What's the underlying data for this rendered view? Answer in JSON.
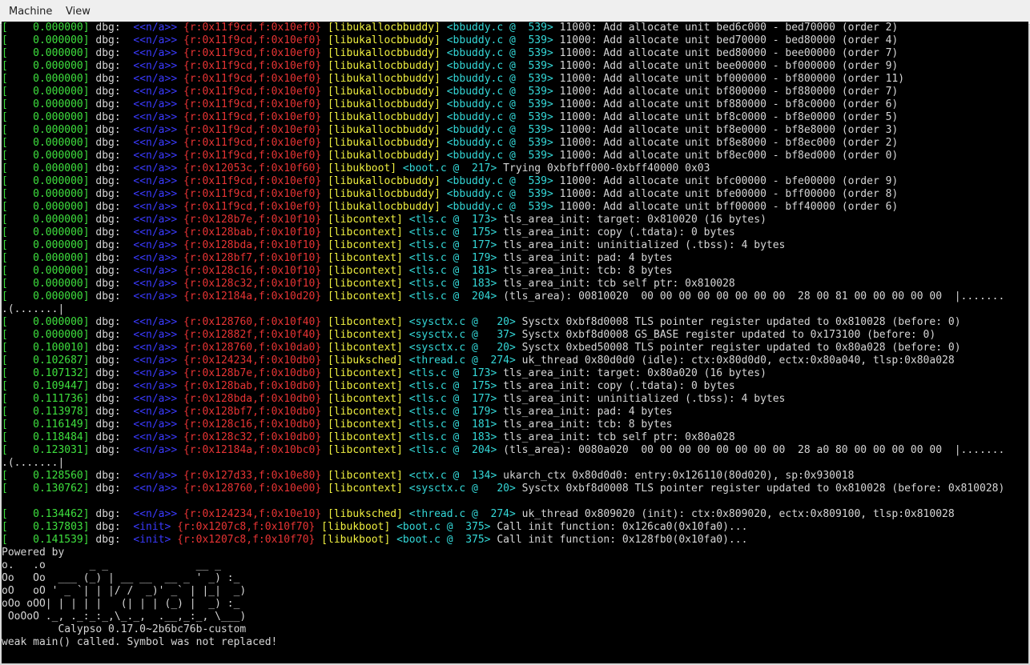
{
  "menu": {
    "machine": "Machine",
    "view": "View"
  },
  "log": [
    {
      "ts": "[    0.000000]",
      "lvl": " dbg: ",
      "ctx": " <<n/a>>",
      "frame": " {r:0x11f9cd,f:0x10ef0}",
      "lib": " [libukallocbbuddy]",
      "src": " <bbuddy.c @  539>",
      "msg": " 11000: Add allocate unit bed6c000 - bed70000 (order 2)"
    },
    {
      "ts": "[    0.000000]",
      "lvl": " dbg: ",
      "ctx": " <<n/a>>",
      "frame": " {r:0x11f9cd,f:0x10ef0}",
      "lib": " [libukallocbbuddy]",
      "src": " <bbuddy.c @  539>",
      "msg": " 11000: Add allocate unit bed70000 - bed80000 (order 4)"
    },
    {
      "ts": "[    0.000000]",
      "lvl": " dbg: ",
      "ctx": " <<n/a>>",
      "frame": " {r:0x11f9cd,f:0x10ef0}",
      "lib": " [libukallocbbuddy]",
      "src": " <bbuddy.c @  539>",
      "msg": " 11000: Add allocate unit bed80000 - bee00000 (order 7)"
    },
    {
      "ts": "[    0.000000]",
      "lvl": " dbg: ",
      "ctx": " <<n/a>>",
      "frame": " {r:0x11f9cd,f:0x10ef0}",
      "lib": " [libukallocbbuddy]",
      "src": " <bbuddy.c @  539>",
      "msg": " 11000: Add allocate unit bee00000 - bf000000 (order 9)"
    },
    {
      "ts": "[    0.000000]",
      "lvl": " dbg: ",
      "ctx": " <<n/a>>",
      "frame": " {r:0x11f9cd,f:0x10ef0}",
      "lib": " [libukallocbbuddy]",
      "src": " <bbuddy.c @  539>",
      "msg": " 11000: Add allocate unit bf000000 - bf800000 (order 11)"
    },
    {
      "ts": "[    0.000000]",
      "lvl": " dbg: ",
      "ctx": " <<n/a>>",
      "frame": " {r:0x11f9cd,f:0x10ef0}",
      "lib": " [libukallocbbuddy]",
      "src": " <bbuddy.c @  539>",
      "msg": " 11000: Add allocate unit bf800000 - bf880000 (order 7)"
    },
    {
      "ts": "[    0.000000]",
      "lvl": " dbg: ",
      "ctx": " <<n/a>>",
      "frame": " {r:0x11f9cd,f:0x10ef0}",
      "lib": " [libukallocbbuddy]",
      "src": " <bbuddy.c @  539>",
      "msg": " 11000: Add allocate unit bf880000 - bf8c0000 (order 6)"
    },
    {
      "ts": "[    0.000000]",
      "lvl": " dbg: ",
      "ctx": " <<n/a>>",
      "frame": " {r:0x11f9cd,f:0x10ef0}",
      "lib": " [libukallocbbuddy]",
      "src": " <bbuddy.c @  539>",
      "msg": " 11000: Add allocate unit bf8c0000 - bf8e0000 (order 5)"
    },
    {
      "ts": "[    0.000000]",
      "lvl": " dbg: ",
      "ctx": " <<n/a>>",
      "frame": " {r:0x11f9cd,f:0x10ef0}",
      "lib": " [libukallocbbuddy]",
      "src": " <bbuddy.c @  539>",
      "msg": " 11000: Add allocate unit bf8e0000 - bf8e8000 (order 3)"
    },
    {
      "ts": "[    0.000000]",
      "lvl": " dbg: ",
      "ctx": " <<n/a>>",
      "frame": " {r:0x11f9cd,f:0x10ef0}",
      "lib": " [libukallocbbuddy]",
      "src": " <bbuddy.c @  539>",
      "msg": " 11000: Add allocate unit bf8e8000 - bf8ec000 (order 2)"
    },
    {
      "ts": "[    0.000000]",
      "lvl": " dbg: ",
      "ctx": " <<n/a>>",
      "frame": " {r:0x11f9cd,f:0x10ef0}",
      "lib": " [libukallocbbuddy]",
      "src": " <bbuddy.c @  539>",
      "msg": " 11000: Add allocate unit bf8ec000 - bf8ed000 (order 0)"
    },
    {
      "ts": "[    0.000000]",
      "lvl": " dbg: ",
      "ctx": " <<n/a>>",
      "frame": " {r:0x12053c,f:0x10f60}",
      "lib": " [libukboot]",
      "src": " <boot.c @  217>",
      "msg": " Trying 0xbfbff000-0xbff40000 0x03"
    },
    {
      "ts": "[    0.000000]",
      "lvl": " dbg: ",
      "ctx": " <<n/a>>",
      "frame": " {r:0x11f9cd,f:0x10ef0}",
      "lib": " [libukallocbbuddy]",
      "src": " <bbuddy.c @  539>",
      "msg": " 11000: Add allocate unit bfc00000 - bfe00000 (order 9)"
    },
    {
      "ts": "[    0.000000]",
      "lvl": " dbg: ",
      "ctx": " <<n/a>>",
      "frame": " {r:0x11f9cd,f:0x10ef0}",
      "lib": " [libukallocbbuddy]",
      "src": " <bbuddy.c @  539>",
      "msg": " 11000: Add allocate unit bfe00000 - bff00000 (order 8)"
    },
    {
      "ts": "[    0.000000]",
      "lvl": " dbg: ",
      "ctx": " <<n/a>>",
      "frame": " {r:0x11f9cd,f:0x10ef0}",
      "lib": " [libukallocbbuddy]",
      "src": " <bbuddy.c @  539>",
      "msg": " 11000: Add allocate unit bff00000 - bff40000 (order 6)"
    },
    {
      "ts": "[    0.000000]",
      "lvl": " dbg: ",
      "ctx": " <<n/a>>",
      "frame": " {r:0x128b7e,f:0x10f10}",
      "lib": " [libcontext]",
      "src": " <tls.c @  173>",
      "msg": " tls_area_init: target: 0x810020 (16 bytes)"
    },
    {
      "ts": "[    0.000000]",
      "lvl": " dbg: ",
      "ctx": " <<n/a>>",
      "frame": " {r:0x128bab,f:0x10f10}",
      "lib": " [libcontext]",
      "src": " <tls.c @  175>",
      "msg": " tls_area_init: copy (.tdata): 0 bytes"
    },
    {
      "ts": "[    0.000000]",
      "lvl": " dbg: ",
      "ctx": " <<n/a>>",
      "frame": " {r:0x128bda,f:0x10f10}",
      "lib": " [libcontext]",
      "src": " <tls.c @  177>",
      "msg": " tls_area_init: uninitialized (.tbss): 4 bytes"
    },
    {
      "ts": "[    0.000000]",
      "lvl": " dbg: ",
      "ctx": " <<n/a>>",
      "frame": " {r:0x128bf7,f:0x10f10}",
      "lib": " [libcontext]",
      "src": " <tls.c @  179>",
      "msg": " tls_area_init: pad: 4 bytes"
    },
    {
      "ts": "[    0.000000]",
      "lvl": " dbg: ",
      "ctx": " <<n/a>>",
      "frame": " {r:0x128c16,f:0x10f10}",
      "lib": " [libcontext]",
      "src": " <tls.c @  181>",
      "msg": " tls_area_init: tcb: 8 bytes"
    },
    {
      "ts": "[    0.000000]",
      "lvl": " dbg: ",
      "ctx": " <<n/a>>",
      "frame": " {r:0x128c32,f:0x10f10}",
      "lib": " [libcontext]",
      "src": " <tls.c @  183>",
      "msg": " tls_area_init: tcb self ptr: 0x810028"
    },
    {
      "ts": "[    0.000000]",
      "lvl": " dbg: ",
      "ctx": " <<n/a>>",
      "frame": " {r:0x12184a,f:0x10d20}",
      "lib": " [libcontext]",
      "src": " <tls.c @  204>",
      "msg": " (tls_area): 00810020  00 00 00 00 00 00 00 00  28 00 81 00 00 00 00 00  |......."
    },
    {
      "raw": ".(.......|"
    },
    {
      "ts": "[    0.000000]",
      "lvl": " dbg: ",
      "ctx": " <<n/a>>",
      "frame": " {r:0x128760,f:0x10f40}",
      "lib": " [libcontext]",
      "src": " <sysctx.c @   20>",
      "msg": " Sysctx 0xbf8d0008 TLS pointer register updated to 0x810028 (before: 0)"
    },
    {
      "ts": "[    0.000000]",
      "lvl": " dbg: ",
      "ctx": " <<n/a>>",
      "frame": " {r:0x12882f,f:0x10f40}",
      "lib": " [libcontext]",
      "src": " <sysctx.c @   37>",
      "msg": " Sysctx 0xbf8d0008 GS_BASE register updated to 0x173100 (before: 0)"
    },
    {
      "ts": "[    0.100010]",
      "lvl": " dbg: ",
      "ctx": " <<n/a>>",
      "frame": " {r:0x128760,f:0x10da0}",
      "lib": " [libcontext]",
      "src": " <sysctx.c @   20>",
      "msg": " Sysctx 0xbed50008 TLS pointer register updated to 0x80a028 (before: 0)"
    },
    {
      "ts": "[    0.102687]",
      "lvl": " dbg: ",
      "ctx": " <<n/a>>",
      "frame": " {r:0x124234,f:0x10db0}",
      "lib": " [libuksched]",
      "src": " <thread.c @  274>",
      "msg": " uk_thread 0x80d0d0 (idle): ctx:0x80d0d0, ectx:0x80a040, tlsp:0x80a028"
    },
    {
      "ts": "[    0.107132]",
      "lvl": " dbg: ",
      "ctx": " <<n/a>>",
      "frame": " {r:0x128b7e,f:0x10db0}",
      "lib": " [libcontext]",
      "src": " <tls.c @  173>",
      "msg": " tls_area_init: target: 0x80a020 (16 bytes)"
    },
    {
      "ts": "[    0.109447]",
      "lvl": " dbg: ",
      "ctx": " <<n/a>>",
      "frame": " {r:0x128bab,f:0x10db0}",
      "lib": " [libcontext]",
      "src": " <tls.c @  175>",
      "msg": " tls_area_init: copy (.tdata): 0 bytes"
    },
    {
      "ts": "[    0.111736]",
      "lvl": " dbg: ",
      "ctx": " <<n/a>>",
      "frame": " {r:0x128bda,f:0x10db0}",
      "lib": " [libcontext]",
      "src": " <tls.c @  177>",
      "msg": " tls_area_init: uninitialized (.tbss): 4 bytes"
    },
    {
      "ts": "[    0.113978]",
      "lvl": " dbg: ",
      "ctx": " <<n/a>>",
      "frame": " {r:0x128bf7,f:0x10db0}",
      "lib": " [libcontext]",
      "src": " <tls.c @  179>",
      "msg": " tls_area_init: pad: 4 bytes"
    },
    {
      "ts": "[    0.116149]",
      "lvl": " dbg: ",
      "ctx": " <<n/a>>",
      "frame": " {r:0x128c16,f:0x10db0}",
      "lib": " [libcontext]",
      "src": " <tls.c @  181>",
      "msg": " tls_area_init: tcb: 8 bytes"
    },
    {
      "ts": "[    0.118484]",
      "lvl": " dbg: ",
      "ctx": " <<n/a>>",
      "frame": " {r:0x128c32,f:0x10db0}",
      "lib": " [libcontext]",
      "src": " <tls.c @  183>",
      "msg": " tls_area_init: tcb self ptr: 0x80a028"
    },
    {
      "ts": "[    0.123031]",
      "lvl": " dbg: ",
      "ctx": " <<n/a>>",
      "frame": " {r:0x12184a,f:0x10bc0}",
      "lib": " [libcontext]",
      "src": " <tls.c @  204>",
      "msg": " (tls_area): 0080a020  00 00 00 00 00 00 00 00  28 a0 80 00 00 00 00 00  |......."
    },
    {
      "raw": ".(.......|"
    },
    {
      "ts": "[    0.128560]",
      "lvl": " dbg: ",
      "ctx": " <<n/a>>",
      "frame": " {r:0x127d33,f:0x10e80}",
      "lib": " [libcontext]",
      "src": " <ctx.c @  134>",
      "msg": " ukarch_ctx 0x80d0d0: entry:0x126110(80d020), sp:0x930018"
    },
    {
      "ts": "[    0.130762]",
      "lvl": " dbg: ",
      "ctx": " <<n/a>>",
      "frame": " {r:0x128760,f:0x10e00}",
      "lib": " [libcontext]",
      "src": " <sysctx.c @   20>",
      "msg": " Sysctx 0xbf8d0008 TLS pointer register updated to 0x810028 (before: 0x810028)"
    },
    {
      "raw": ""
    },
    {
      "ts": "[    0.134462]",
      "lvl": " dbg: ",
      "ctx": " <<n/a>>",
      "frame": " {r:0x124234,f:0x10e10}",
      "lib": " [libuksched]",
      "src": " <thread.c @  274>",
      "msg": " uk_thread 0x809020 (init): ctx:0x809020, ectx:0x809100, tlsp:0x810028"
    },
    {
      "ts": "[    0.137803]",
      "lvl": " dbg: ",
      "ctx": " <init>",
      "frame": " {r:0x1207c8,f:0x10f70}",
      "lib": " [libukboot]",
      "src": " <boot.c @  375>",
      "msg": " Call init function: 0x126ca0(0x10fa0)..."
    },
    {
      "ts": "[    0.141539]",
      "lvl": " dbg: ",
      "ctx": " <init>",
      "frame": " {r:0x1207c8,f:0x10f70}",
      "lib": " [libukboot]",
      "src": " <boot.c @  375>",
      "msg": " Call init function: 0x128fb0(0x10fa0)..."
    },
    {
      "raw": "Powered by"
    },
    {
      "raw": "o.   .o       _ _              __ _"
    },
    {
      "raw": "Oo   Oo  ___ (_) | __ __  __ _ ' _) :_"
    },
    {
      "raw": "oO   oO ' _ `| | |/ /  _)' _` | |_|  _)"
    },
    {
      "raw": "oOo oOO| | | | |   (| | | (_) |  _) :_"
    },
    {
      "raw": " OoOoO ._, ._:_:_,\\_._,  .__,_:_, \\___)"
    },
    {
      "raw": "         Calypso 0.17.0~2b6bc76b-custom"
    },
    {
      "raw": "weak main() called. Symbol was not replaced!"
    }
  ]
}
